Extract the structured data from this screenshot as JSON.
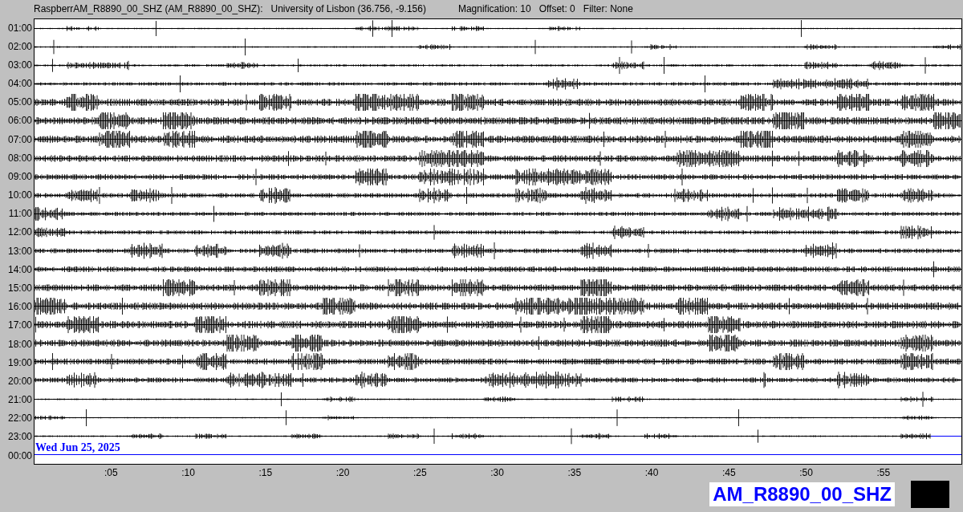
{
  "header": {
    "title": "RaspberrAM_R8890_00_SHZ (AM_R8890_00_SHZ):",
    "location": "University of Lisbon (36.756, -9.156)",
    "magnification": "Magnification: 10",
    "offset": "Offset: 0",
    "filter": "Filter: None"
  },
  "rows": [
    {
      "label": "01:00",
      "kind": "trace"
    },
    {
      "label": "02:00",
      "kind": "trace"
    },
    {
      "label": "03:00",
      "kind": "trace"
    },
    {
      "label": "04:00",
      "kind": "trace"
    },
    {
      "label": "05:00",
      "kind": "trace"
    },
    {
      "label": "06:00",
      "kind": "trace"
    },
    {
      "label": "07:00",
      "kind": "trace"
    },
    {
      "label": "08:00",
      "kind": "trace"
    },
    {
      "label": "09:00",
      "kind": "trace"
    },
    {
      "label": "10:00",
      "kind": "trace"
    },
    {
      "label": "11:00",
      "kind": "trace"
    },
    {
      "label": "12:00",
      "kind": "trace"
    },
    {
      "label": "13:00",
      "kind": "trace"
    },
    {
      "label": "14:00",
      "kind": "trace"
    },
    {
      "label": "15:00",
      "kind": "trace"
    },
    {
      "label": "16:00",
      "kind": "trace"
    },
    {
      "label": "17:00",
      "kind": "trace"
    },
    {
      "label": "18:00",
      "kind": "trace"
    },
    {
      "label": "19:00",
      "kind": "trace"
    },
    {
      "label": "20:00",
      "kind": "trace"
    },
    {
      "label": "21:00",
      "kind": "trace"
    },
    {
      "label": "22:00",
      "kind": "trace"
    },
    {
      "label": "23:00",
      "kind": "current"
    },
    {
      "label": "00:00",
      "kind": "empty"
    }
  ],
  "date": "Wed Jun 25, 2025",
  "x_ticks": [
    ":05",
    ":10",
    ":15",
    ":20",
    ":25",
    ":30",
    ":35",
    ":40",
    ":45",
    ":50",
    ":55"
  ],
  "station": "AM_R8890_00_SHZ"
}
